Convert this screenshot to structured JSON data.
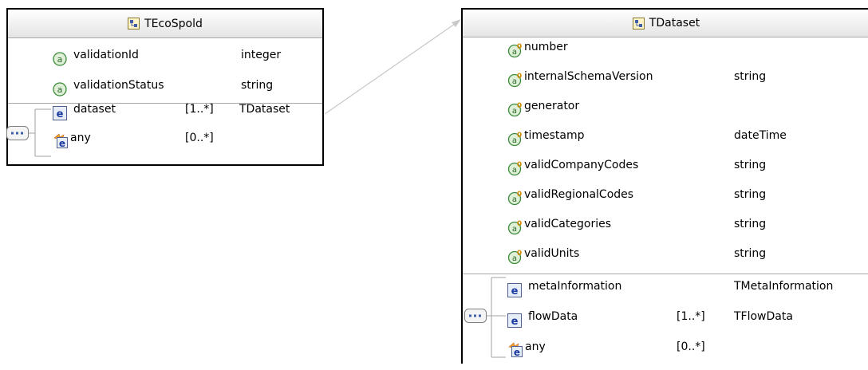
{
  "left": {
    "title": "TEcoSpold",
    "attributes": [
      {
        "name": "validationId",
        "type": "integer"
      },
      {
        "name": "validationStatus",
        "type": "string"
      }
    ],
    "elements": [
      {
        "name": "dataset",
        "mult": "[1..*]",
        "type": "TDataset"
      },
      {
        "name": "any",
        "mult": "[0..*]",
        "type": ""
      }
    ]
  },
  "right": {
    "title": "TDataset",
    "attributes": [
      {
        "name": "number",
        "type": ""
      },
      {
        "name": "internalSchemaVersion",
        "type": "string"
      },
      {
        "name": "generator",
        "type": ""
      },
      {
        "name": "timestamp",
        "type": "dateTime"
      },
      {
        "name": "validCompanyCodes",
        "type": "string"
      },
      {
        "name": "validRegionalCodes",
        "type": "string"
      },
      {
        "name": "validCategories",
        "type": "string"
      },
      {
        "name": "validUnits",
        "type": "string"
      }
    ],
    "elements": [
      {
        "name": "metaInformation",
        "mult": "",
        "type": "TMetaInformation"
      },
      {
        "name": "flowData",
        "mult": "[1..*]",
        "type": "TFlowData"
      },
      {
        "name": "any",
        "mult": "[0..*]",
        "type": ""
      }
    ]
  },
  "icons": {
    "type": "complex-type-icon",
    "attribute": "attribute-icon",
    "optional_attribute": "optional-attribute-icon",
    "element": "element-icon",
    "any_element": "any-element-icon",
    "sequence": "sequence-compositor-icon"
  }
}
